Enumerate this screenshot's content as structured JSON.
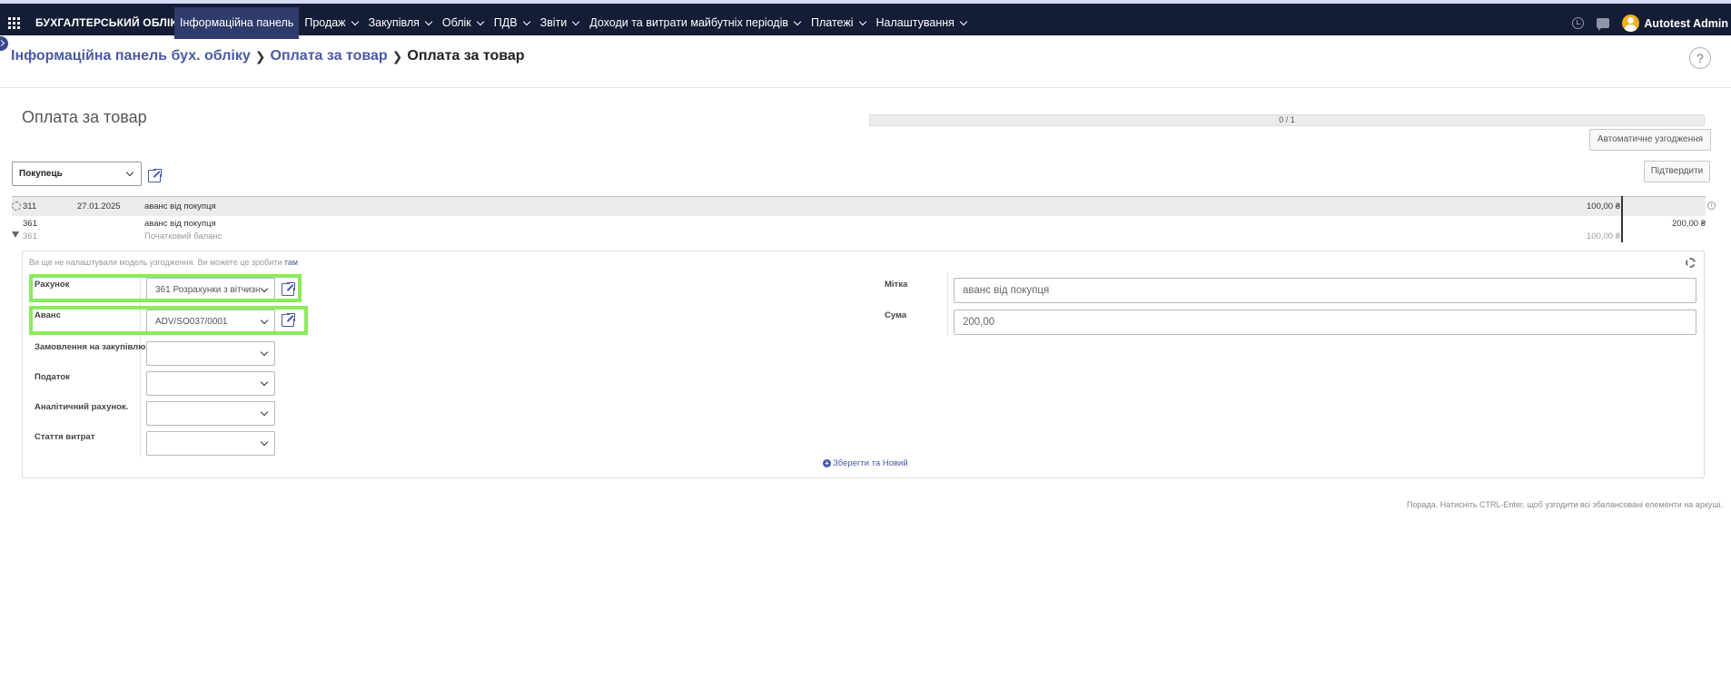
{
  "navbar": {
    "brand": "БУХГАЛТЕРСЬКИЙ ОБЛІК",
    "menu": [
      {
        "label": "Інформаційна панель",
        "active": true,
        "dropdown": false
      },
      {
        "label": "Продаж",
        "dropdown": true
      },
      {
        "label": "Закупівля",
        "dropdown": true
      },
      {
        "label": "Облік",
        "dropdown": true
      },
      {
        "label": "ПДВ",
        "dropdown": true
      },
      {
        "label": "Звіти",
        "dropdown": true
      },
      {
        "label": "Доходи та витрати майбутніх періодів",
        "dropdown": true
      },
      {
        "label": "Платежі",
        "dropdown": true
      },
      {
        "label": "Налаштування",
        "dropdown": true
      }
    ],
    "user": "Autotest Admin",
    "icons": [
      "apps-icon",
      "clock-icon",
      "chat-icon",
      "avatar"
    ]
  },
  "breadcrumb": {
    "items": [
      "Інформаційна панель бух. обліку",
      "Оплата за товар"
    ],
    "current": "Оплата за товар"
  },
  "help_label": "?",
  "page": {
    "title": "Оплата за товар",
    "progress": "0 / 1",
    "auto_reconcile_label": "Автоматичне узгодження",
    "validate_label": "Підтвердити",
    "partner": "Покупець"
  },
  "lines": [
    {
      "account": "311",
      "date": "27.01.2025",
      "label": "аванс від покупця",
      "debit": "100,00 ₴",
      "credit": ""
    },
    {
      "account": "361",
      "date": "",
      "label": "аванс від покупця",
      "debit": "",
      "credit": "200,00 ₴"
    },
    {
      "account": "361",
      "date": "",
      "label": "Початковий баланс",
      "debit": "100,00 ₴",
      "credit": ""
    }
  ],
  "form": {
    "note_text": "Ви ще не налаштували модель узгодження. Ви можете це зробити",
    "note_link": "там",
    "labels": {
      "account": "Рахунок",
      "advance": "Аванс",
      "purchase_order": "Замовлення на закупівлю",
      "tax": "Податок",
      "analytic": "Аналітичний рахунок.",
      "expense": "Стаття витрат",
      "label": "Мітка",
      "amount": "Сума"
    },
    "values": {
      "account": "361 Розрахунки з вітчизн",
      "advance": "ADV/SO037/0001",
      "purchase_order": "",
      "tax": "",
      "analytic": "",
      "expense": "",
      "label": "аванс від покупця",
      "amount": "200,00"
    },
    "save_new_label": "Зберегти та Новий"
  },
  "hint": "Порада. Натисніть CTRL-Enter, щоб узгодити всі збалансовані елементи на аркуші.",
  "colors": {
    "navbar": "#151c36",
    "accent": "#4a5aa3",
    "highlight": "#8aeb5c"
  }
}
